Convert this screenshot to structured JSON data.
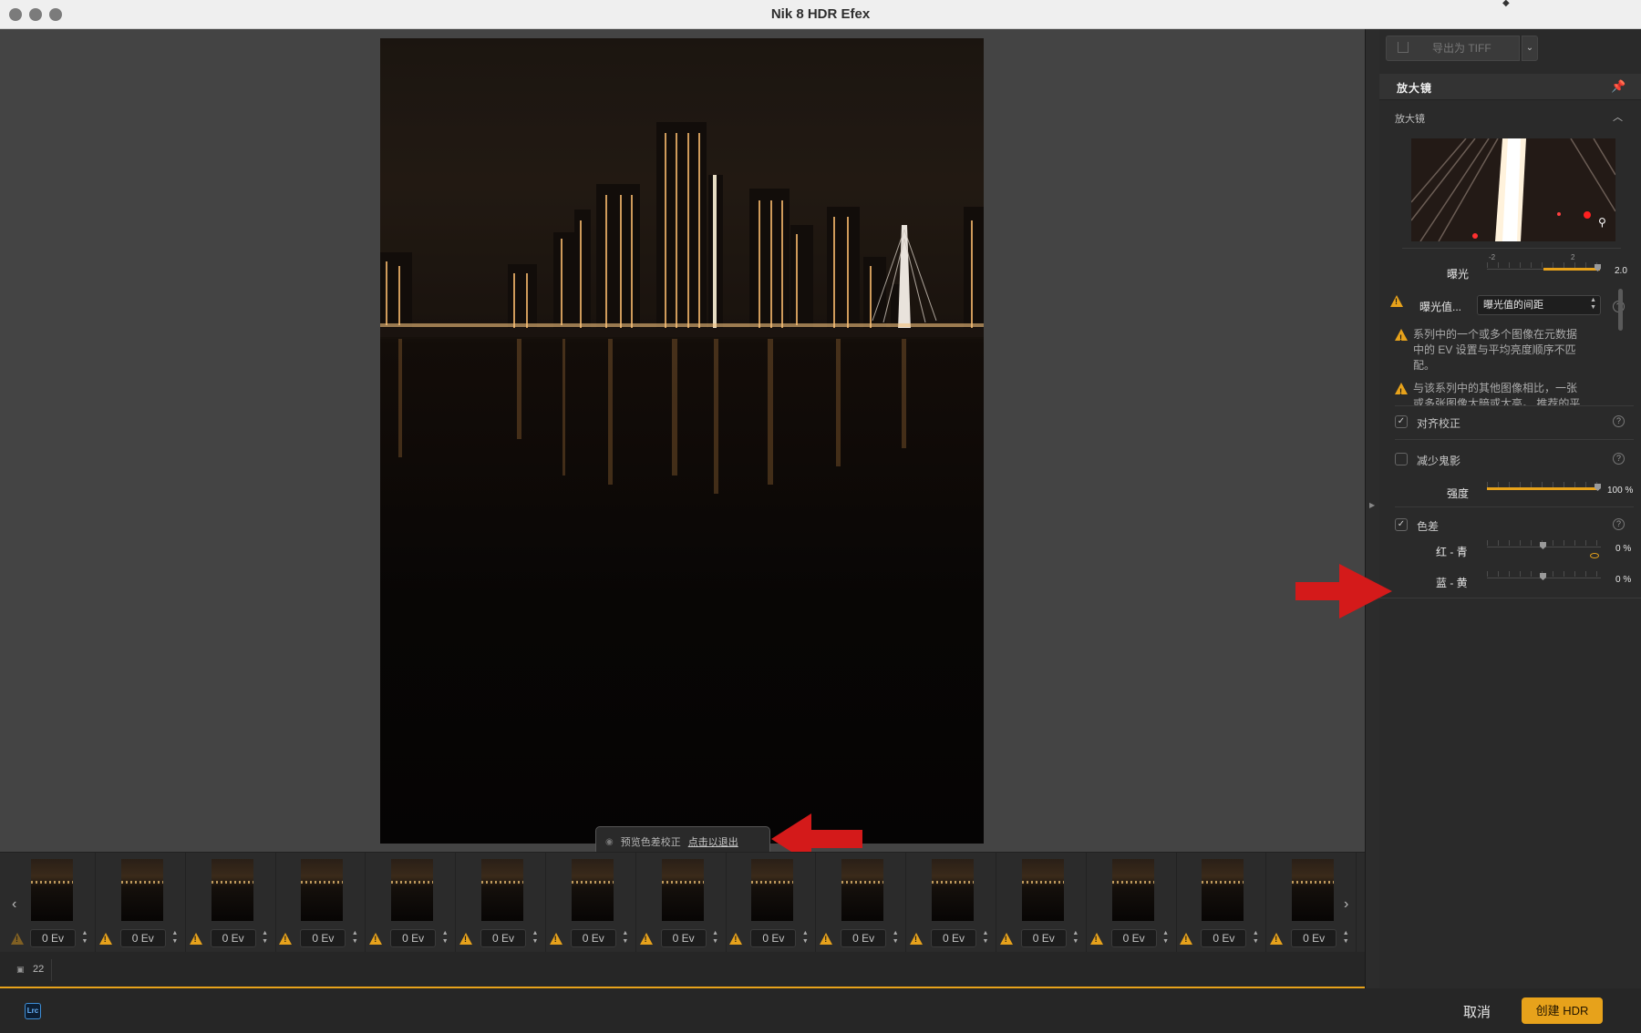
{
  "window": {
    "title": "Nik 8 HDR Efex"
  },
  "preview": {
    "toast_text": "预览色差校正",
    "toast_link": "点击以退出"
  },
  "filmstrip": {
    "items": [
      {
        "ev": "0 Ev"
      },
      {
        "ev": "0 Ev"
      },
      {
        "ev": "0 Ev"
      },
      {
        "ev": "0 Ev"
      },
      {
        "ev": "0 Ev"
      },
      {
        "ev": "0 Ev"
      },
      {
        "ev": "0 Ev"
      },
      {
        "ev": "0 Ev"
      },
      {
        "ev": "0 Ev"
      },
      {
        "ev": "0 Ev"
      },
      {
        "ev": "0 Ev"
      },
      {
        "ev": "0 Ev"
      },
      {
        "ev": "0 Ev"
      },
      {
        "ev": "0 Ev"
      },
      {
        "ev": "0 Ev"
      }
    ],
    "image_count": "22"
  },
  "footer": {
    "lrc_badge": "Lrc",
    "cancel_label": "取消",
    "create_label": "创建 HDR"
  },
  "panel": {
    "export_label": "导出为 TIFF",
    "section_title": "放大镜",
    "subsection_title": "放大镜",
    "exposure": {
      "label": "曝光",
      "tick_min": "-2",
      "tick_max": "2",
      "value": "2.0"
    },
    "ev_spacing": {
      "label": "曝光值...",
      "selected": "曝光值的间距"
    },
    "messages": [
      "系列中的一个或多个图像在元数据中的 EV 设置与平均亮度顺序不匹配。",
      "与该系列中的其他图像相比，一张或多张图像太暗或太亮。 推荐的平"
    ],
    "align": {
      "label": "对齐校正",
      "checked": true
    },
    "ghost": {
      "label": "减少鬼影",
      "checked": false
    },
    "strength": {
      "label": "强度",
      "value": "100 %"
    },
    "chroma": {
      "label": "色差",
      "checked": true,
      "red_cyan": {
        "label": "红 - 青",
        "value": "0 %"
      },
      "blue_yellow": {
        "label": "蓝 - 黄",
        "value": "0 %"
      }
    }
  },
  "colors": {
    "accent": "#e7a21b",
    "annotation_arrow": "#d41a1a"
  }
}
